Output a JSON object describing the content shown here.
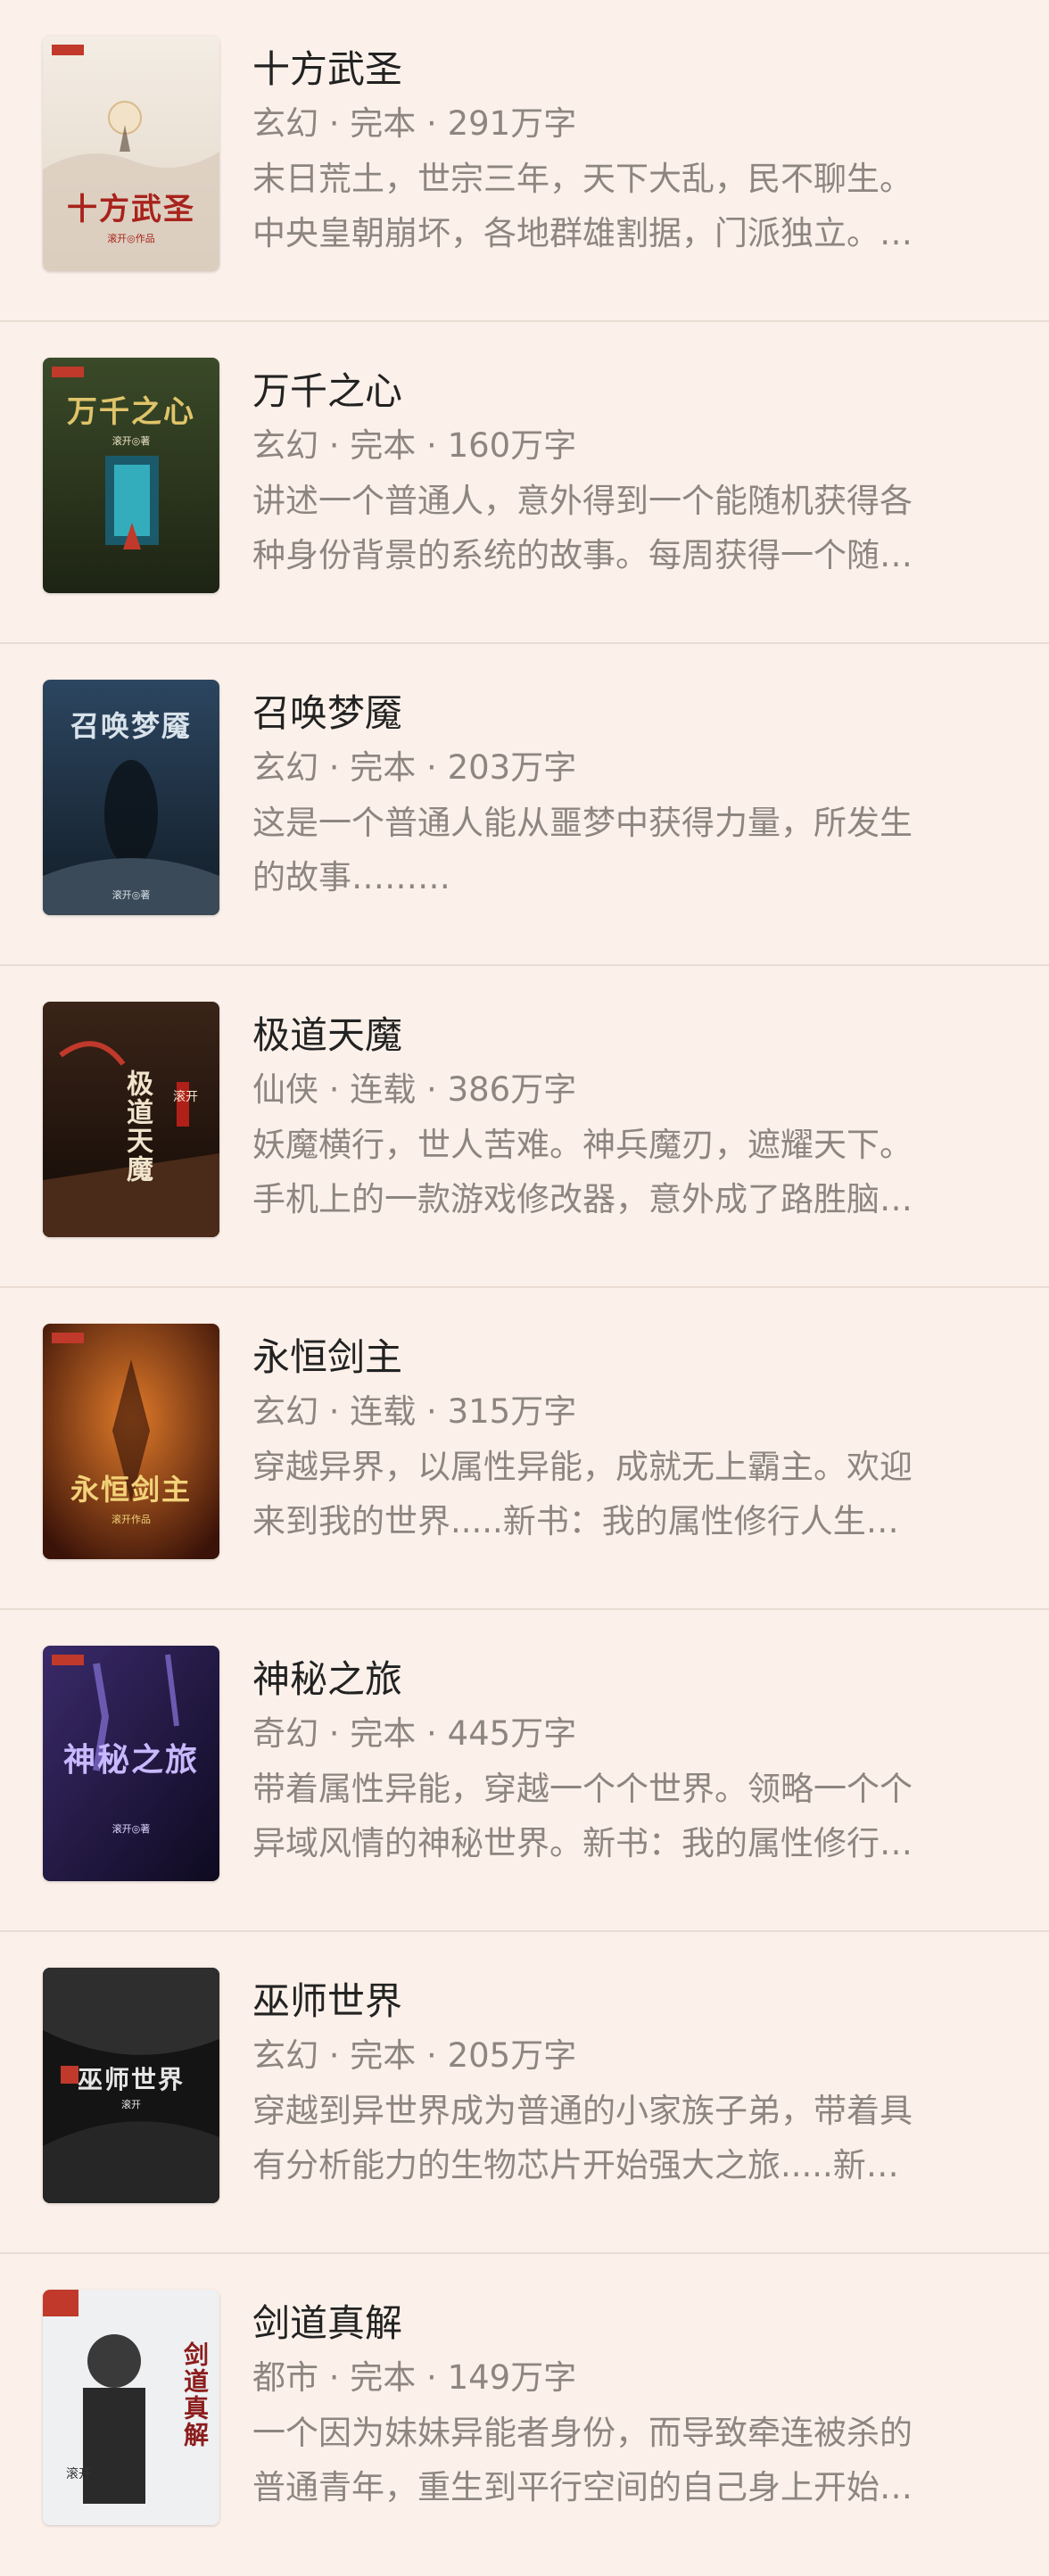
{
  "books": [
    {
      "title": "十方武圣",
      "meta": "玄幻 · 完本 · 291万字",
      "desc_line1": "末日荒土，世宗三年，天下大乱，民不聊生。",
      "desc_line2": "中央皇朝崩坏，各地群雄割据，门派独立。…",
      "cover": {
        "text": "十方武圣",
        "author": "滚开◎作品",
        "bg": "#efe6dc",
        "accent": "#a8231c"
      }
    },
    {
      "title": "万千之心",
      "meta": "玄幻 · 完本 · 160万字",
      "desc_line1": "讲述一个普通人，意外得到一个能随机获得各",
      "desc_line2": "种身份背景的系统的故事。每周获得一个随…",
      "cover": {
        "text": "万千之心",
        "author": "滚开◎著",
        "bg": "#2d3a1e",
        "accent": "#e0c46a"
      }
    },
    {
      "title": "召唤梦魇",
      "meta": "玄幻 · 完本 · 203万字",
      "desc_line1": "这是一个普通人能从噩梦中获得力量，所发生",
      "desc_line2": "的故事………",
      "cover": {
        "text": "召唤梦魇",
        "author": "滚开◎著",
        "bg": "#1f3142",
        "accent": "#cfd8e0"
      }
    },
    {
      "title": "极道天魔",
      "meta": "仙侠 · 连载 · 386万字",
      "desc_line1": "妖魔横行，世人苦难。神兵魔刃，遮耀天下。",
      "desc_line2": "手机上的一款游戏修改器，意外成了路胜脑…",
      "cover": {
        "text": "极道天魔",
        "author": "滚开",
        "bg": "#2a1a12",
        "accent": "#e8d9c0"
      }
    },
    {
      "title": "永恒剑主",
      "meta": "玄幻 · 连载 · 315万字",
      "desc_line1": "穿越异界，以属性异能，成就无上霸主。欢迎",
      "desc_line2": "来到我的世界.....新书：我的属性修行人生…",
      "cover": {
        "text": "永恒剑主",
        "author": "滚开作品",
        "bg": "#4a1c0e",
        "accent": "#f2d27a"
      }
    },
    {
      "title": "神秘之旅",
      "meta": "奇幻 · 完本 · 445万字",
      "desc_line1": "带着属性异能，穿越一个个世界。领略一个个",
      "desc_line2": "异域风情的神秘世界。新书：我的属性修行…",
      "cover": {
        "text": "神秘之旅",
        "author": "滚开◎著",
        "bg": "#231a3e",
        "accent": "#b9a6ff"
      }
    },
    {
      "title": "巫师世界",
      "meta": "玄幻 · 完本 · 205万字",
      "desc_line1": "穿越到异世界成为普通的小家族子弟，带着具",
      "desc_line2": "有分析能力的生物芯片开始强大之旅.....新…",
      "cover": {
        "text": "巫师世界",
        "author": "滚开",
        "bg": "#121212",
        "accent": "#d8d8d8"
      }
    },
    {
      "title": "剑道真解",
      "meta": "都市 · 完本 · 149万字",
      "desc_line1": "一个因为妹妹异能者身份，而导致牵连被杀的",
      "desc_line2": "普通青年，重生到平行空间的自己身上开始…",
      "cover": {
        "text": "剑道真解",
        "author": "滚开",
        "bg": "#e9ecef",
        "accent": "#8c1d1d"
      }
    }
  ]
}
